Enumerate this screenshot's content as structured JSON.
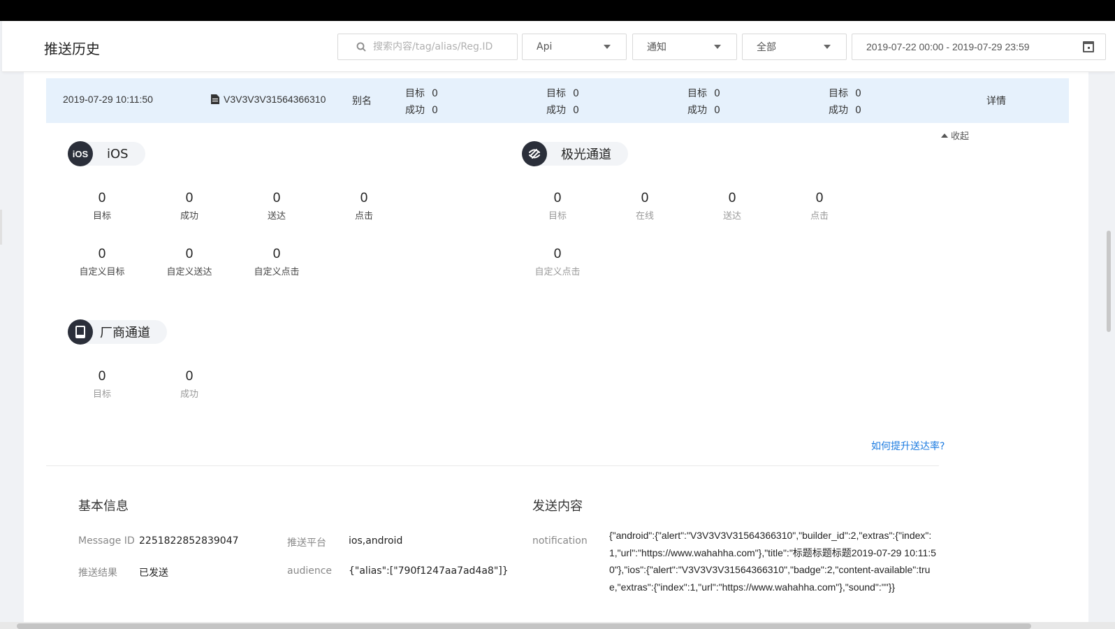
{
  "header": {
    "title": "推送历史",
    "search_placeholder": "搜索内容/tag/alias/Reg.ID",
    "filters": [
      "Api",
      "通知",
      "全部"
    ],
    "date_range": "2019-07-22 00:00 - 2019-07-29 23:59"
  },
  "row": {
    "time": "2019-07-29 10:11:50",
    "message": "V3V3V3V31564366310",
    "type": "别名",
    "stats": [
      {
        "target_label": "目标",
        "target": "0",
        "success_label": "成功",
        "success": "0"
      },
      {
        "target_label": "目标",
        "target": "0",
        "success_label": "成功",
        "success": "0"
      },
      {
        "target_label": "目标",
        "target": "0",
        "success_label": "成功",
        "success": "0"
      },
      {
        "target_label": "目标",
        "target": "0",
        "success_label": "成功",
        "success": "0"
      }
    ],
    "detail_label": "详情"
  },
  "panel": {
    "collapse_label": "收起",
    "ios": {
      "title": "iOS",
      "icon_text": "iOS",
      "metrics": [
        {
          "value": "0",
          "label": "目标"
        },
        {
          "value": "0",
          "label": "成功"
        },
        {
          "value": "0",
          "label": "送达"
        },
        {
          "value": "0",
          "label": "点击"
        },
        {
          "value": "0",
          "label": "自定义目标"
        },
        {
          "value": "0",
          "label": "自定义送达"
        },
        {
          "value": "0",
          "label": "自定义点击"
        }
      ]
    },
    "jpush": {
      "title": "极光通道",
      "metrics": [
        {
          "value": "0",
          "label": "目标"
        },
        {
          "value": "0",
          "label": "在线"
        },
        {
          "value": "0",
          "label": "送达"
        },
        {
          "value": "0",
          "label": "点击"
        },
        {
          "value": "0",
          "label": "自定义点击"
        }
      ]
    },
    "vendor": {
      "title": "厂商通道",
      "metrics": [
        {
          "value": "0",
          "label": "目标"
        },
        {
          "value": "0",
          "label": "成功"
        }
      ]
    },
    "help_link": "如何提升送达率?"
  },
  "basic": {
    "title": "基本信息",
    "message_id_label": "Message ID",
    "message_id": "2251822852839047",
    "platform_label": "推送平台",
    "platform": "ios,android",
    "result_label": "推送结果",
    "result": "已发送",
    "audience_label": "audience",
    "audience": "{\"alias\":[\"790f1247aa7ad4a8\"]}"
  },
  "content": {
    "title": "发送内容",
    "notification_label": "notification",
    "notification": "{\"android\":{\"alert\":\"V3V3V3V31564366310\",\"builder_id\":2,\"extras\":{\"index\":1,\"url\":\"https://www.wahahha.com\"},\"title\":\"标题标题标题2019-07-29 10:11:50\"},\"ios\":{\"alert\":\"V3V3V3V31564366310\",\"badge\":2,\"content-available\":true,\"extras\":{\"index\":1,\"url\":\"https://www.wahahha.com\"},\"sound\":\"\"}}"
  }
}
